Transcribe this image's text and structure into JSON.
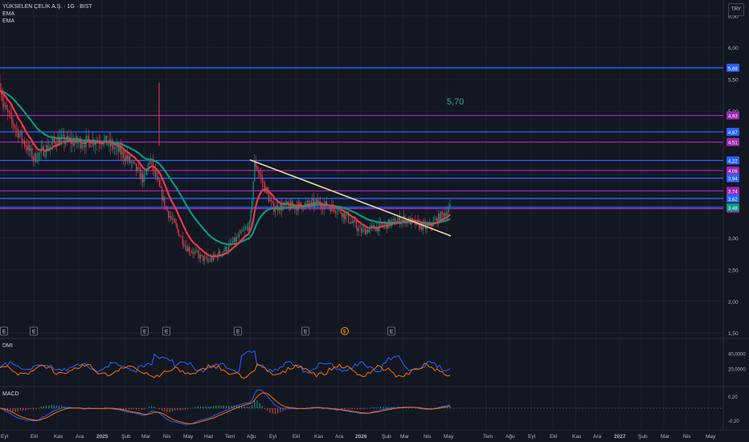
{
  "header": {
    "symbol_line": "YÜKSELEN ÇELİK A.Ş. · 1G · BIST",
    "indicators": [
      "EMA",
      "EMA"
    ],
    "currency": "TRY"
  },
  "annotation": "5,70",
  "chart_data": {
    "type": "candlestick",
    "price_axis": {
      "ylim": [
        1.3,
        6.75
      ],
      "ticks": [
        {
          "v": 6.5,
          "label": "6,50"
        },
        {
          "v": 6.0,
          "label": "6,00"
        },
        {
          "v": 5.5,
          "label": "5,50"
        },
        {
          "v": 5.0,
          "label": "5,00"
        },
        {
          "v": 4.5,
          "label": "4,50"
        },
        {
          "v": 4.0,
          "label": "4,00"
        },
        {
          "v": 3.5,
          "label": "3,50"
        },
        {
          "v": 3.0,
          "label": "3,00"
        },
        {
          "v": 2.5,
          "label": "2,50"
        },
        {
          "v": 2.0,
          "label": "2,00"
        },
        {
          "v": 1.5,
          "label": "1,50"
        }
      ]
    },
    "time_axis": [
      "Eyl",
      "Ekl",
      "Kas",
      "Ara",
      "2025",
      "Şub",
      "Mar",
      "Nis",
      "May",
      "Haz",
      "Tem",
      "Ağu",
      "Eyl",
      "Ekl",
      "Kas",
      "Ara",
      "2026",
      "Şub",
      "Mar",
      "Nis",
      "May",
      "Tem",
      "Ağu",
      "Eyl",
      "Ekl",
      "Kas",
      "Ara",
      "2027",
      "Şub",
      "Mar",
      "Nis",
      "May"
    ],
    "hlines": [
      {
        "v": 5.68,
        "label": "5,68",
        "color": "#2962ff"
      },
      {
        "v": 4.93,
        "label": "4,93",
        "color": "#9c27b0"
      },
      {
        "v": 4.67,
        "label": "4,67",
        "color": "#2962ff"
      },
      {
        "v": 4.51,
        "label": "4,51",
        "color": "#9c27b0"
      },
      {
        "v": 4.22,
        "label": "4,22",
        "color": "#2962ff"
      },
      {
        "v": 4.06,
        "label": "4,06",
        "color": "#9c27b0"
      },
      {
        "v": 3.94,
        "label": "3,94",
        "color": "#2962ff"
      },
      {
        "v": 3.74,
        "label": "3,74",
        "color": "#9c27b0"
      },
      {
        "v": 3.62,
        "label": "3,62",
        "color": "#2962ff"
      },
      {
        "v": 3.48,
        "label": "3,48",
        "color": "#2962ff"
      },
      {
        "v": 3.46,
        "label": "3,46",
        "color": "#9c27b0"
      }
    ],
    "last_price": {
      "v": 3.48,
      "label": "3,48",
      "color": "#089981"
    },
    "trendline": {
      "from": {
        "date": "Ağu 2025",
        "v": 4.23
      },
      "to": {
        "date": "May 2026",
        "v": 3.03
      }
    },
    "events": [
      {
        "date": "Eyl 2024",
        "label": "E"
      },
      {
        "date": "Ekl 2024",
        "label": "E"
      },
      {
        "date": "Mar 2025",
        "label": "E"
      },
      {
        "date": "Nis 2025",
        "label": "E"
      },
      {
        "date": "Tem 2025",
        "label": "E"
      },
      {
        "date": "Kas 2025",
        "label": "E"
      },
      {
        "date": "Ara 2025",
        "label": "$"
      },
      {
        "date": "Mar 2026",
        "label": "E"
      }
    ],
    "price_path": [
      {
        "date": "Ağu 2024",
        "v": 5.75
      },
      {
        "date": "Eyl 2024",
        "v": 5.05
      },
      {
        "date": "Ekl 2024",
        "v": 4.25
      },
      {
        "date": "Kas 2024",
        "v": 4.55
      },
      {
        "date": "Ara 2024",
        "v": 4.5
      },
      {
        "date": "2025",
        "v": 4.55
      },
      {
        "date": "Şub 2025",
        "v": 4.3
      },
      {
        "date": "Mar 2025",
        "v": 3.9
      },
      {
        "date": "Mar 2025",
        "v": 4.25
      },
      {
        "date": "Nis 2025",
        "v": 3.45
      },
      {
        "date": "May 2025",
        "v": 2.85
      },
      {
        "date": "Haz 2025",
        "v": 2.62
      },
      {
        "date": "Tem 2025",
        "v": 2.85
      },
      {
        "date": "Ağu 2025",
        "v": 3.2
      },
      {
        "date": "Ağu 2025",
        "v": 4.2
      },
      {
        "date": "Eyl 2025",
        "v": 3.48
      },
      {
        "date": "Ekl 2025",
        "v": 3.5
      },
      {
        "date": "Kas 2025",
        "v": 3.55
      },
      {
        "date": "Ara 2025",
        "v": 3.45
      },
      {
        "date": "2026",
        "v": 3.1
      },
      {
        "date": "Şub 2026",
        "v": 3.2
      },
      {
        "date": "Mar 2026",
        "v": 3.3
      },
      {
        "date": "Nis 2026",
        "v": 3.15
      },
      {
        "date": "May 2026",
        "v": 3.48
      }
    ],
    "ema_fast": {
      "color": "#f23645"
    },
    "ema_slow": {
      "color": "#089981"
    },
    "dmi": {
      "title": "DMI",
      "ticks": [
        {
          "v": 40,
          "label": "40,0000"
        },
        {
          "v": 20,
          "label": "20,0000"
        }
      ],
      "plus_color": "#2962ff",
      "minus_color": "#ff6d00"
    },
    "macd": {
      "title": "MACD",
      "ticks": [
        {
          "v": 0.2,
          "label": "0,20"
        },
        {
          "v": -0.2,
          "label": "-0,20"
        }
      ],
      "macd_color": "#2962ff",
      "signal_color": "#ff6d00"
    }
  }
}
